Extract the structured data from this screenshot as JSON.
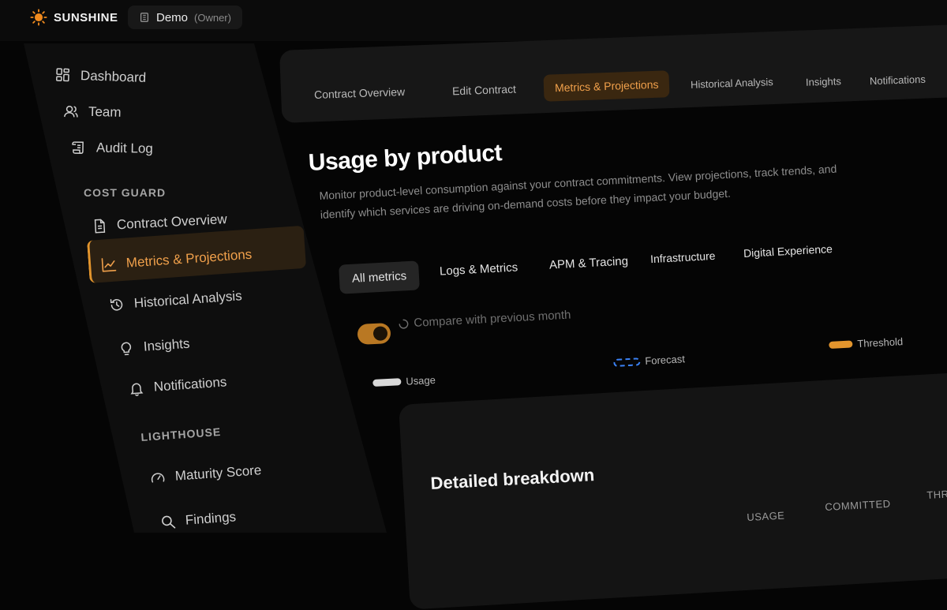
{
  "brand": {
    "name": "SUNSHINE"
  },
  "workspace": {
    "name": "Demo",
    "role": "(Owner)"
  },
  "sidebar": {
    "items": [
      {
        "label": "Dashboard",
        "icon": "grid-icon"
      },
      {
        "label": "Team",
        "icon": "users-icon"
      },
      {
        "label": "Audit Log",
        "icon": "scroll-icon"
      }
    ],
    "sections": [
      {
        "title": "COST GUARD",
        "items": [
          {
            "label": "Contract Overview",
            "icon": "document-icon"
          },
          {
            "label": "Metrics & Projections",
            "icon": "chart-line-icon",
            "active": true
          },
          {
            "label": "Historical Analysis",
            "icon": "history-icon"
          },
          {
            "label": "Insights",
            "icon": "lightbulb-icon"
          },
          {
            "label": "Notifications",
            "icon": "bell-icon"
          }
        ]
      },
      {
        "title": "LIGHTHOUSE",
        "items": [
          {
            "label": "Maturity Score",
            "icon": "gauge-icon"
          },
          {
            "label": "Findings",
            "icon": "search-icon"
          }
        ]
      }
    ]
  },
  "tabs": [
    {
      "label": "Contract Overview"
    },
    {
      "label": "Edit Contract"
    },
    {
      "label": "Metrics & Projections",
      "active": true
    },
    {
      "label": "Historical Analysis"
    },
    {
      "label": "Insights"
    },
    {
      "label": "Notifications"
    }
  ],
  "main": {
    "title": "Usage by product",
    "description": "Monitor product-level consumption against your contract commitments. View projections, track trends, and identify which services are driving on-demand costs before they impact your budget.",
    "filters": [
      {
        "label": "All metrics",
        "active": true
      },
      {
        "label": "Logs & Metrics"
      },
      {
        "label": "APM & Tracing"
      },
      {
        "label": "Infrastructure"
      },
      {
        "label": "Digital Experience"
      }
    ],
    "compare_toggle": {
      "label": "Compare with previous month",
      "on": true
    },
    "legend": {
      "usage": "Usage",
      "forecast": "Forecast",
      "threshold": "Threshold"
    },
    "breakdown": {
      "title": "Detailed breakdown",
      "columns": [
        "USAGE",
        "COMMITTED",
        "THRE"
      ]
    }
  },
  "colors": {
    "accent": "#e3952d",
    "forecast": "#3b82f6",
    "usage": "#d9d9d9",
    "background": "#050505"
  }
}
